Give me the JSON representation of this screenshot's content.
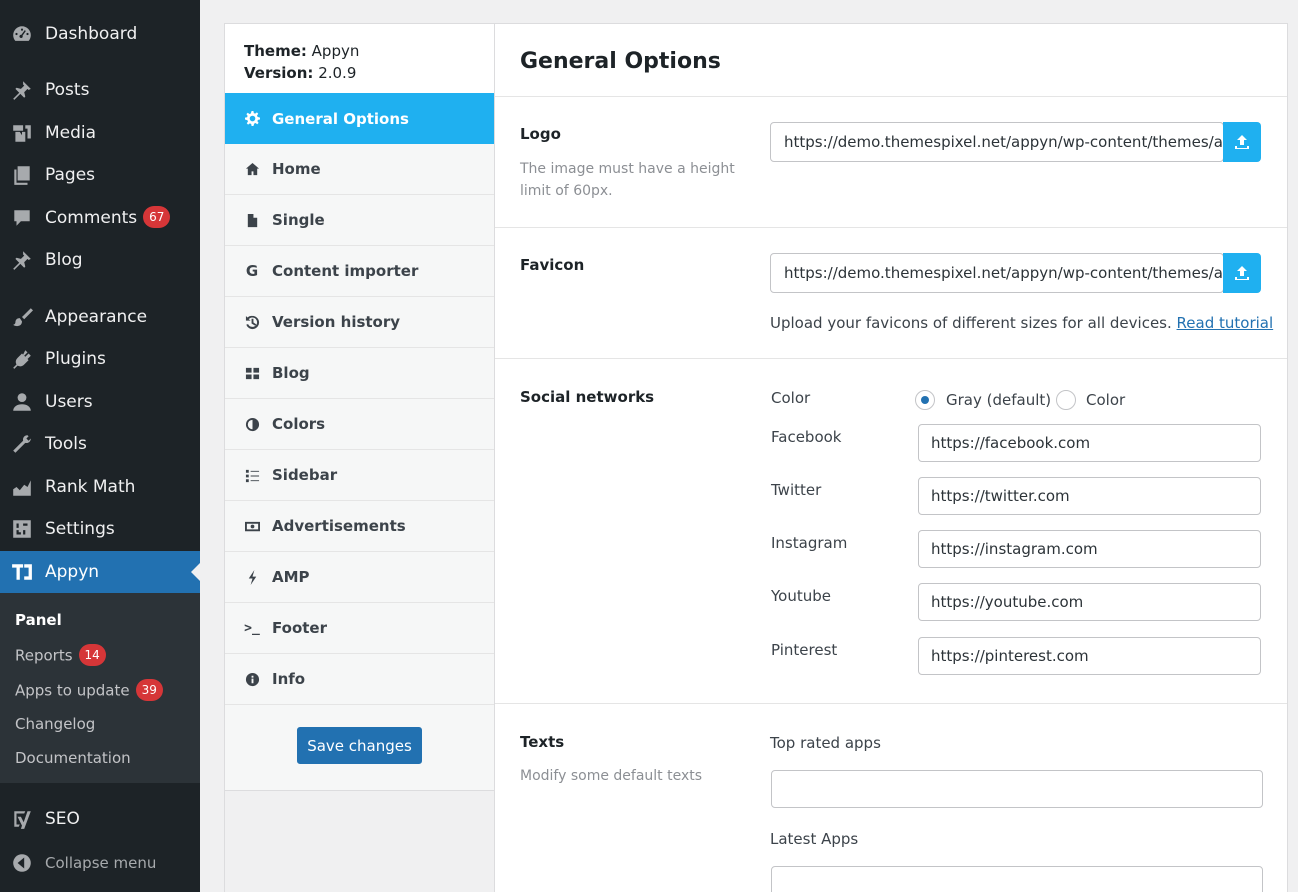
{
  "wp_menu": {
    "items": [
      {
        "key": "dashboard",
        "label": "Dashboard"
      },
      {
        "key": "posts",
        "label": "Posts"
      },
      {
        "key": "media",
        "label": "Media"
      },
      {
        "key": "pages",
        "label": "Pages"
      },
      {
        "key": "comments",
        "label": "Comments",
        "badge": "67"
      },
      {
        "key": "blog",
        "label": "Blog"
      },
      {
        "key": "appearance",
        "label": "Appearance"
      },
      {
        "key": "plugins",
        "label": "Plugins"
      },
      {
        "key": "users",
        "label": "Users"
      },
      {
        "key": "tools",
        "label": "Tools"
      },
      {
        "key": "rank-math",
        "label": "Rank Math"
      },
      {
        "key": "settings",
        "label": "Settings"
      },
      {
        "key": "appyn",
        "label": "Appyn"
      },
      {
        "key": "seo",
        "label": "SEO"
      }
    ],
    "submenu": [
      {
        "label": "Panel"
      },
      {
        "label": "Reports",
        "badge": "14"
      },
      {
        "label": "Apps to update",
        "badge": "39"
      },
      {
        "label": "Changelog"
      },
      {
        "label": "Documentation"
      }
    ],
    "collapse_label": "Collapse menu"
  },
  "theme_info": {
    "theme_label": "Theme:",
    "theme_value": "Appyn",
    "version_label": "Version:",
    "version_value": "2.0.9"
  },
  "panel_nav": [
    {
      "label": "General Options",
      "icon": "gear-icon"
    },
    {
      "label": "Home",
      "icon": "home-icon"
    },
    {
      "label": "Single",
      "icon": "file-icon"
    },
    {
      "label": "Content importer",
      "icon": "google-icon"
    },
    {
      "label": "Version history",
      "icon": "history-icon"
    },
    {
      "label": "Blog",
      "icon": "grid-icon"
    },
    {
      "label": "Colors",
      "icon": "contrast-icon"
    },
    {
      "label": "Sidebar",
      "icon": "list-icon"
    },
    {
      "label": "Advertisements",
      "icon": "money-icon"
    },
    {
      "label": "AMP",
      "icon": "bolt-icon"
    },
    {
      "label": "Footer",
      "icon": "terminal-icon"
    },
    {
      "label": "Info",
      "icon": "info-icon"
    }
  ],
  "save_label": "Save changes",
  "page_title": "General Options",
  "logo": {
    "label": "Logo",
    "description": "The image must have a height limit of 60px.",
    "value": "https://demo.themespixel.net/appyn/wp-content/themes/appyn/images/logo.png"
  },
  "favicon": {
    "label": "Favicon",
    "value": "https://demo.themespixel.net/appyn/wp-content/themes/appyn/images/favicon.ico",
    "help": "Upload your favicons of different sizes for all devices.",
    "help_link": "Read tutorial"
  },
  "social": {
    "label": "Social networks",
    "color_label": "Color",
    "options": [
      "Gray (default)",
      "Color"
    ],
    "selected": "Gray (default)",
    "networks": [
      {
        "label": "Facebook",
        "value": "https://facebook.com"
      },
      {
        "label": "Twitter",
        "value": "https://twitter.com"
      },
      {
        "label": "Instagram",
        "value": "https://instagram.com"
      },
      {
        "label": "Youtube",
        "value": "https://youtube.com"
      },
      {
        "label": "Pinterest",
        "value": "https://pinterest.com"
      }
    ]
  },
  "texts": {
    "label": "Texts",
    "description": "Modify some default texts",
    "fields": [
      {
        "label": "Top rated apps",
        "value": ""
      },
      {
        "label": "Latest Apps",
        "value": ""
      }
    ]
  },
  "colors": {
    "accent": "#1fb0f0",
    "wp_blue": "#2271b1",
    "badge_red": "#d63638",
    "sidebar_bg": "#1d2327"
  }
}
